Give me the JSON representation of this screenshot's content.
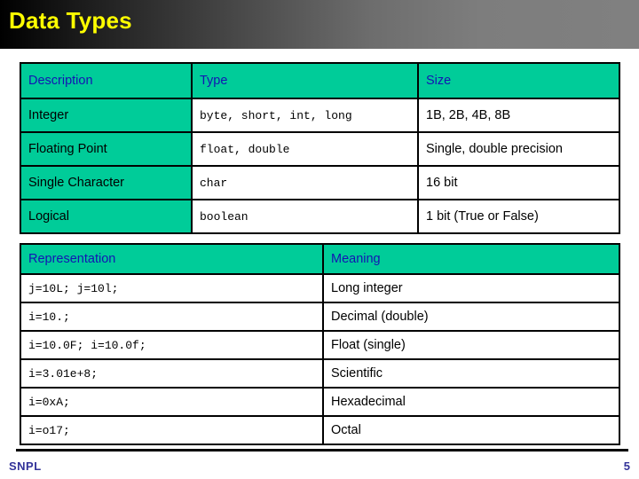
{
  "slide": {
    "title": "Data Types",
    "title_color": "#ffff00",
    "banner_gradient_from": "#000000",
    "banner_gradient_to": "#808080",
    "accent_teal": "#00CC99",
    "header_text_color": "#1414b4",
    "footer_text_color": "#333399"
  },
  "tables": [
    {
      "name": "data-types-table",
      "headers": [
        "Description",
        "Type",
        "Size"
      ],
      "rows": [
        [
          "Integer",
          "byte, short, int, long",
          "1B, 2B, 4B, 8B"
        ],
        [
          "Floating Point",
          "float, double",
          "Single, double precision"
        ],
        [
          "Single Character",
          "char",
          "16 bit"
        ],
        [
          "Logical",
          "boolean",
          "1 bit (True or False)"
        ]
      ]
    },
    {
      "name": "literal-representation-table",
      "headers": [
        "Representation",
        "Meaning"
      ],
      "rows": [
        [
          "j=10L; j=10l;",
          "Long integer"
        ],
        [
          "i=10.;",
          "Decimal (double)"
        ],
        [
          "i=10.0F; i=10.0f;",
          "Float (single)"
        ],
        [
          "i=3.01e+8;",
          "Scientific"
        ],
        [
          "i=0xA;",
          "Hexadecimal"
        ],
        [
          "i=o17;",
          "Octal"
        ]
      ]
    }
  ],
  "footer": {
    "left_label": "SNPL",
    "page_number": "5"
  }
}
